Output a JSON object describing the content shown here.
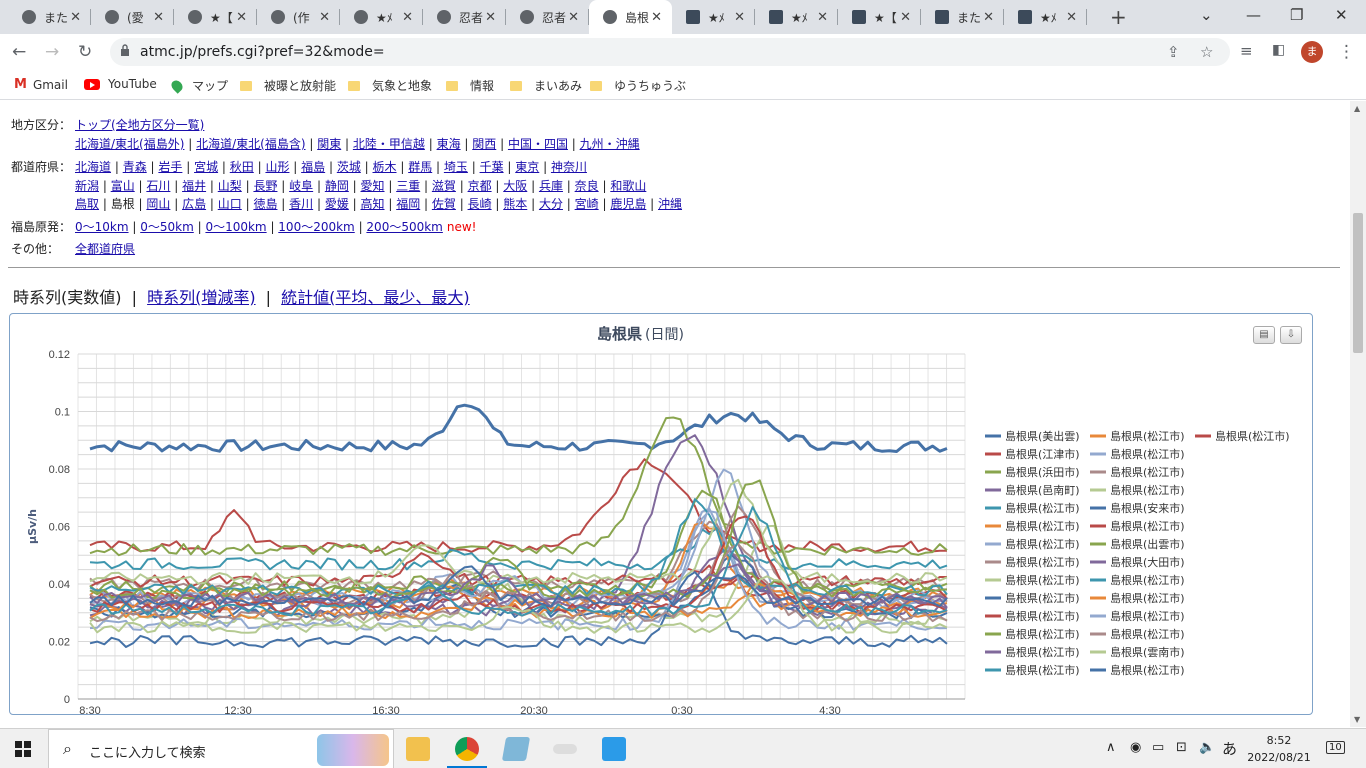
{
  "tabs": [
    {
      "title": "また",
      "icon": "globe-icon"
    },
    {
      "title": "(愛",
      "icon": "globe-icon"
    },
    {
      "title": "★【",
      "icon": "globe-icon"
    },
    {
      "title": "(作",
      "icon": "globe-icon"
    },
    {
      "title": "★ﾒ",
      "icon": "globe-icon"
    },
    {
      "title": "忍者",
      "icon": "globe-icon"
    },
    {
      "title": "忍者",
      "icon": "globe-icon"
    },
    {
      "title": "島根",
      "icon": "globe-icon",
      "active": true
    },
    {
      "title": "★ﾒ",
      "icon": "site-icon"
    },
    {
      "title": "★ﾒ",
      "icon": "site-icon"
    },
    {
      "title": "★【",
      "icon": "site-icon"
    },
    {
      "title": "また",
      "icon": "site-icon"
    },
    {
      "title": "★ﾒ",
      "icon": "site-icon"
    }
  ],
  "toolbar": {
    "url": "atmc.jp/prefs.cgi?pref=32&mode=",
    "avatar": "ま"
  },
  "bookmarks": [
    {
      "label": "Gmail",
      "type": "gmail"
    },
    {
      "label": "YouTube",
      "type": "youtube"
    },
    {
      "label": "マップ",
      "type": "maps"
    },
    {
      "label": "被曝と放射能",
      "type": "folder"
    },
    {
      "label": "気象と地象",
      "type": "folder"
    },
    {
      "label": "情報",
      "type": "folder"
    },
    {
      "label": "まいあみ",
      "type": "folder"
    },
    {
      "label": "ゆうちゅうぶ",
      "type": "folder"
    }
  ],
  "nav": {
    "region_label": "地方区分：",
    "region_top": "トップ(全地方区分一覧)",
    "regions": [
      "北海道/東北(福島外)",
      "北海道/東北(福島含)",
      "関東",
      "北陸・甲信越",
      "東海",
      "関西",
      "中国・四国",
      "九州・沖縄"
    ],
    "pref_label": "都道府県：",
    "prefs_row1": [
      "北海道",
      "青森",
      "岩手",
      "宮城",
      "秋田",
      "山形",
      "福島",
      "茨城",
      "栃木",
      "群馬",
      "埼玉",
      "千葉",
      "東京",
      "神奈川"
    ],
    "prefs_row2": [
      "新潟",
      "富山",
      "石川",
      "福井",
      "山梨",
      "長野",
      "岐阜",
      "静岡",
      "愛知",
      "三重",
      "滋賀",
      "京都",
      "大阪",
      "兵庫",
      "奈良",
      "和歌山"
    ],
    "prefs_row3": [
      "鳥取",
      "島根",
      "岡山",
      "広島",
      "山口",
      "徳島",
      "香川",
      "愛媛",
      "高知",
      "福岡",
      "佐賀",
      "長崎",
      "熊本",
      "大分",
      "宮崎",
      "鹿児島",
      "沖縄"
    ],
    "current_pref": "島根",
    "fuku_label": "福島原発：",
    "fuku_links": [
      "0～10km",
      "0～50km",
      "0～100km",
      "100～200km",
      "200～500km"
    ],
    "new_label": "new!",
    "other_label": "その他：",
    "other_link": "全都道府県"
  },
  "subtabs": {
    "current": "時系列(実数値)",
    "links": [
      "時系列(増減率)",
      "統計値(平均、最少、最大)"
    ],
    "sep": "|"
  },
  "chart_data": {
    "type": "line",
    "title": "島根県",
    "subtitle": "(日間)",
    "ylabel": "μSv/h",
    "ylim": [
      0,
      0.12
    ],
    "yticks": [
      0,
      0.02,
      0.04,
      0.06,
      0.08,
      0.1,
      0.12
    ],
    "xticks": [
      "8:30",
      "12:30",
      "16:30",
      "20:30",
      "0:30",
      "4:30"
    ],
    "grid": true,
    "legend_position": "right",
    "series": [
      {
        "name": "島根県(美出雲)",
        "color": "#4572a7",
        "base": 0.088
      },
      {
        "name": "島根県(松江市)",
        "color": "#e8883a",
        "base": 0.037
      },
      {
        "name": "島根県(松江市)",
        "color": "#b94a48",
        "base": 0.053
      },
      {
        "name": "島根県(江津市)",
        "color": "#b94a48",
        "base": 0.036
      },
      {
        "name": "島根県(松江市)",
        "color": "#93a9cf",
        "base": 0.034
      },
      {
        "name": "島根県(浜田市)",
        "color": "#89a54e",
        "base": 0.052
      },
      {
        "name": "島根県(松江市)",
        "color": "#aa8a8a",
        "base": 0.04
      },
      {
        "name": "島根県(邑南町)",
        "color": "#80699b",
        "base": 0.031
      },
      {
        "name": "島根県(松江市)",
        "color": "#b5ca92",
        "base": 0.028
      },
      {
        "name": "島根県(松江市)",
        "color": "#3d96ae",
        "base": 0.047
      },
      {
        "name": "島根県(安来市)",
        "color": "#4572a7",
        "base": 0.03
      },
      {
        "name": "島根県(松江市)",
        "color": "#e8883a",
        "base": 0.033
      },
      {
        "name": "島根県(松江市)",
        "color": "#b94a48",
        "base": 0.041
      },
      {
        "name": "島根県(松江市)",
        "color": "#93a9cf",
        "base": 0.036
      },
      {
        "name": "島根県(出雲市)",
        "color": "#89a54e",
        "base": 0.039
      },
      {
        "name": "島根県(松江市)",
        "color": "#aa8a8a",
        "base": 0.035
      },
      {
        "name": "島根県(大田市)",
        "color": "#80699b",
        "base": 0.033
      },
      {
        "name": "島根県(松江市)",
        "color": "#b5ca92",
        "base": 0.042
      },
      {
        "name": "島根県(松江市)",
        "color": "#3d96ae",
        "base": 0.038
      },
      {
        "name": "島根県(松江市)",
        "color": "#4572a7",
        "base": 0.02
      },
      {
        "name": "島根県(松江市)",
        "color": "#e8883a",
        "base": 0.03
      },
      {
        "name": "島根県(松江市)",
        "color": "#b94a48",
        "base": 0.032
      },
      {
        "name": "島根県(松江市)",
        "color": "#93a9cf",
        "base": 0.026
      },
      {
        "name": "島根県(松江市)",
        "color": "#89a54e",
        "base": 0.037
      },
      {
        "name": "島根県(松江市)",
        "color": "#aa8a8a",
        "base": 0.029
      },
      {
        "name": "島根県(松江市)",
        "color": "#80699b",
        "base": 0.035
      },
      {
        "name": "島根県(雲南市)",
        "color": "#b5ca92",
        "base": 0.025
      },
      {
        "name": "島根県(松江市)",
        "color": "#3d96ae",
        "base": 0.031
      },
      {
        "name": "島根県(松江市)",
        "color": "#4572a7",
        "base": 0.034
      }
    ]
  },
  "taskbar": {
    "search_placeholder": "ここに入力して検索",
    "time": "8:52",
    "date": "2022/08/21",
    "ime": "あ",
    "notifications": "10"
  }
}
